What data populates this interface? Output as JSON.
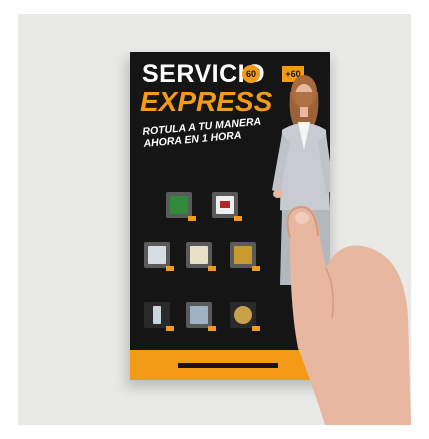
{
  "flyer": {
    "title_line1": "SERVICIO",
    "title_line2": "EXPRESS",
    "badge_60": "60",
    "badge_plus60": "+60",
    "subtitle_line1": "ROTULA A TU MANERA",
    "subtitle_line2": "AHORA EN 1 HORA"
  },
  "colors": {
    "flyer_background": "#151515",
    "accent": "#f39a16",
    "backdrop": "#e9e9e7",
    "skin": "#e8b79f"
  },
  "icons": [
    "businesswoman-figure",
    "hand",
    "trophy",
    "plaque",
    "medal",
    "award-product"
  ]
}
